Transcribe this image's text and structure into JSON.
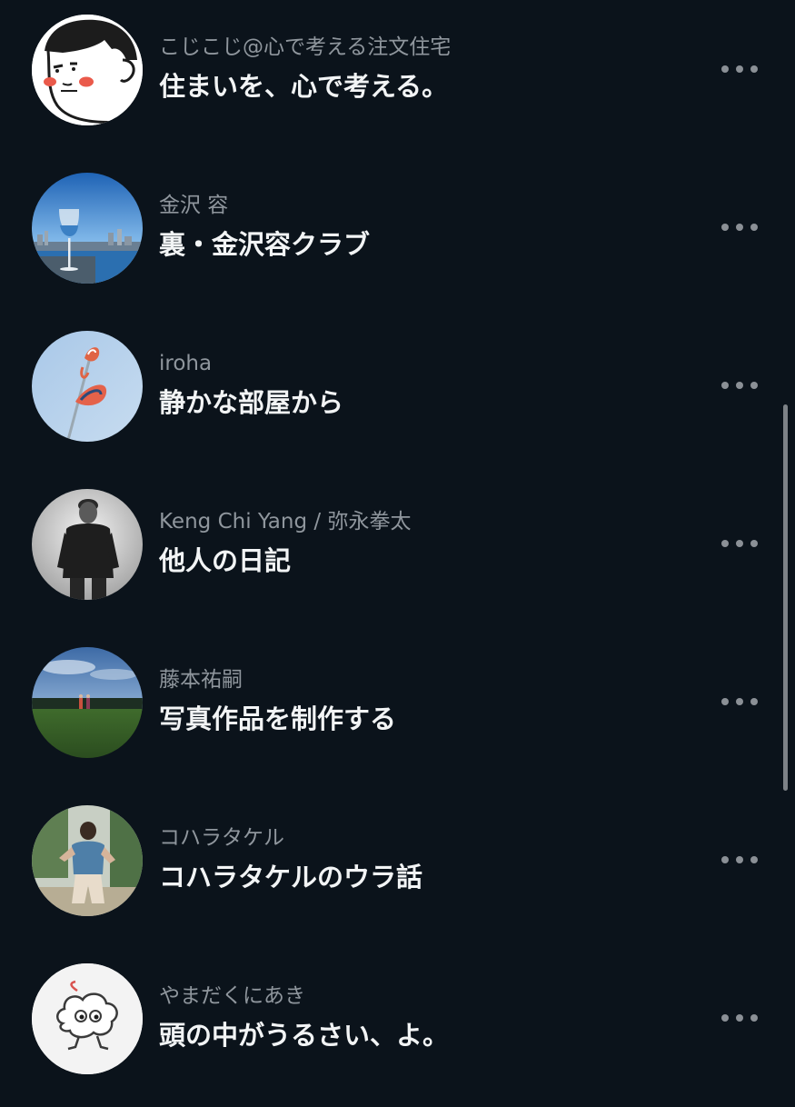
{
  "feed": {
    "items": [
      {
        "author": "こじこじ@心で考える注文住宅",
        "title": "住まいを、心で考える。",
        "avatar_icon": "cartoon-character-avatar"
      },
      {
        "author": "金沢 容",
        "title": "裏・金沢容クラブ",
        "avatar_icon": "wine-glass-cityscape-avatar"
      },
      {
        "author": "iroha",
        "title": "静かな部屋から",
        "avatar_icon": "flower-sky-avatar"
      },
      {
        "author": "Keng Chi Yang / 弥永拳太",
        "title": "他人の日記",
        "avatar_icon": "portrait-photo-avatar"
      },
      {
        "author": "藤本祐嗣",
        "title": "写真作品を制作する",
        "avatar_icon": "field-landscape-avatar"
      },
      {
        "author": "コハラタケル",
        "title": "コハラタケルのウラ話",
        "avatar_icon": "person-photo-avatar"
      },
      {
        "author": "やまだくにあき",
        "title": "頭の中がうるさい、よ。",
        "avatar_icon": "cloud-character-avatar"
      }
    ],
    "more_icon": "more-horizontal-icon"
  },
  "colors": {
    "background": "#0b131b",
    "author_text": "#8f969d",
    "title_text": "#f2f4f5",
    "more_dots": "#8b9096"
  }
}
